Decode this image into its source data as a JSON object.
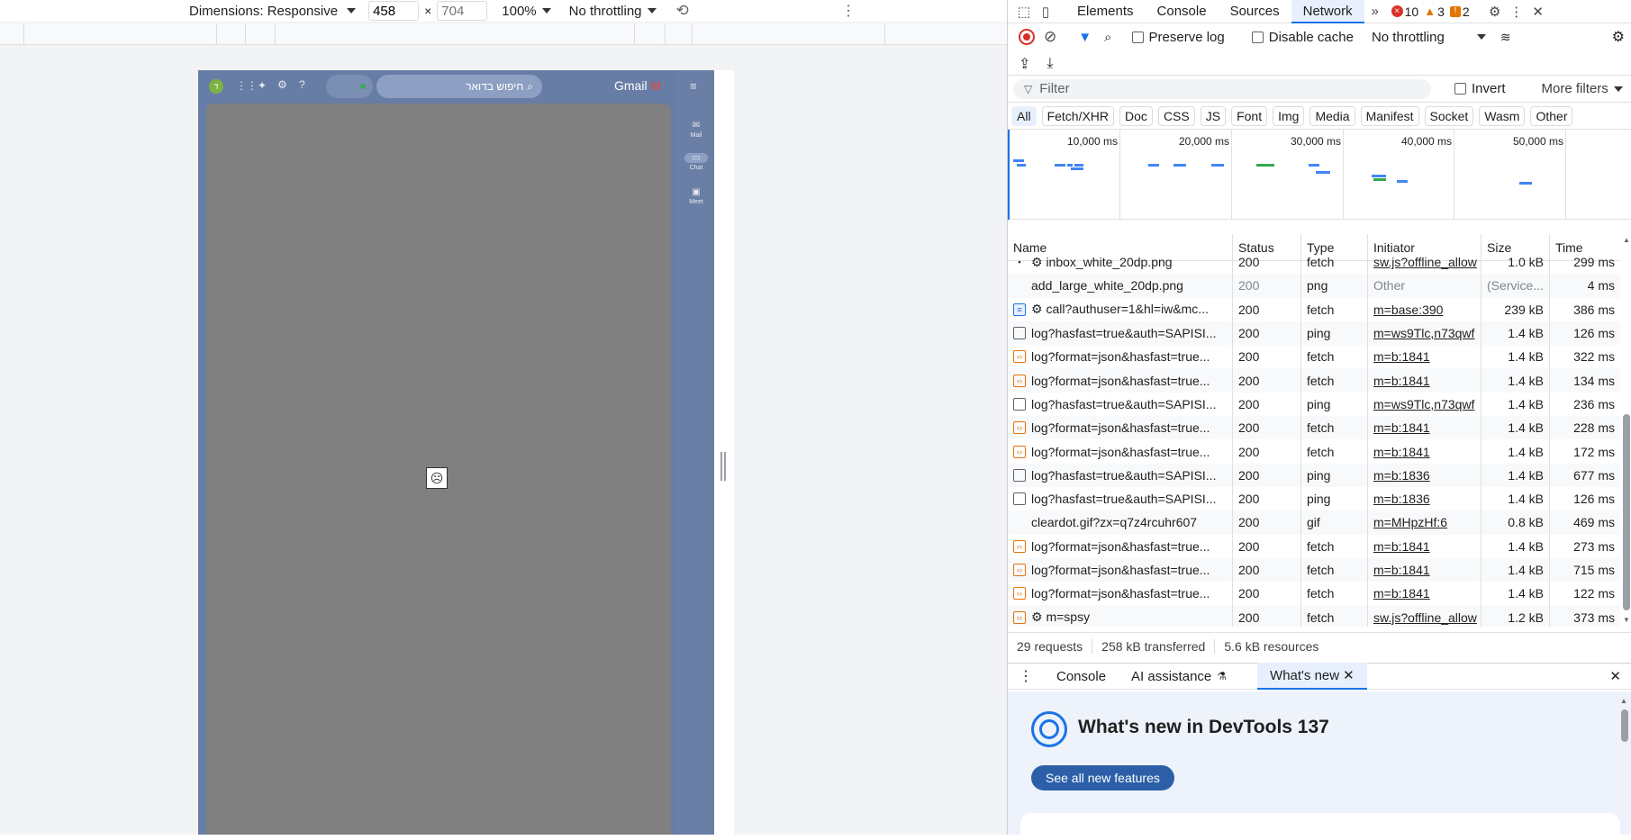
{
  "device_toolbar": {
    "dimensions_label": "Dimensions: Responsive",
    "width": "458",
    "height_placeholder": "704",
    "times": "×",
    "zoom": "100%",
    "throttling": "No throttling"
  },
  "gmail": {
    "search_placeholder": "חיפוש בדואר",
    "logo_text": "Gmail",
    "rail": [
      {
        "icon": "mail-icon",
        "label": "Mail"
      },
      {
        "icon": "chat-icon",
        "label": "Chat"
      },
      {
        "icon": "video-icon",
        "label": "Meet"
      }
    ],
    "avatar_letter": "ד"
  },
  "devtools": {
    "tabs": [
      "Elements",
      "Console",
      "Sources",
      "Network"
    ],
    "active_tab": "Network",
    "errors": "10",
    "warnings": "3",
    "issues": "2",
    "preserve_log": "Preserve log",
    "disable_cache": "Disable cache",
    "throttling": "No throttling",
    "filter_placeholder": "Filter",
    "invert": "Invert",
    "more_filters": "More filters",
    "type_filters": [
      "All",
      "Fetch/XHR",
      "Doc",
      "CSS",
      "JS",
      "Font",
      "Img",
      "Media",
      "Manifest",
      "Socket",
      "Wasm",
      "Other"
    ],
    "overview_labels": [
      "10,000 ms",
      "20,000 ms",
      "30,000 ms",
      "40,000 ms",
      "50,000 ms"
    ],
    "columns": [
      "Name",
      "Status",
      "Type",
      "Initiator",
      "Size",
      "Time"
    ],
    "rows": [
      {
        "icon": "img",
        "name": "⚙ inbox_white_20dp.png",
        "status": "200",
        "type": "fetch",
        "initiator": "sw.js?offline_allow",
        "size": "1.0 kB",
        "time": "299 ms"
      },
      {
        "icon": "none",
        "name": "add_large_white_20dp.png",
        "status": "200",
        "type": "png",
        "initiator": "Other",
        "size": "(Service...",
        "time": "4 ms",
        "dim": true
      },
      {
        "icon": "doc",
        "name": "⚙ call?authuser=1&hl=iw&mc...",
        "status": "200",
        "type": "fetch",
        "initiator": "m=base:390",
        "size": "239 kB",
        "time": "386 ms"
      },
      {
        "icon": "ping",
        "name": "log?hasfast=true&auth=SAPISI...",
        "status": "200",
        "type": "ping",
        "initiator": "m=ws9Tlc,n73qwf",
        "size": "1.4 kB",
        "time": "126 ms"
      },
      {
        "icon": "fetch",
        "name": "log?format=json&hasfast=true...",
        "status": "200",
        "type": "fetch",
        "initiator": "m=b:1841",
        "size": "1.4 kB",
        "time": "322 ms"
      },
      {
        "icon": "fetch",
        "name": "log?format=json&hasfast=true...",
        "status": "200",
        "type": "fetch",
        "initiator": "m=b:1841",
        "size": "1.4 kB",
        "time": "134 ms"
      },
      {
        "icon": "ping",
        "name": "log?hasfast=true&auth=SAPISI...",
        "status": "200",
        "type": "ping",
        "initiator": "m=ws9Tlc,n73qwf",
        "size": "1.4 kB",
        "time": "236 ms"
      },
      {
        "icon": "fetch",
        "name": "log?format=json&hasfast=true...",
        "status": "200",
        "type": "fetch",
        "initiator": "m=b:1841",
        "size": "1.4 kB",
        "time": "228 ms"
      },
      {
        "icon": "fetch",
        "name": "log?format=json&hasfast=true...",
        "status": "200",
        "type": "fetch",
        "initiator": "m=b:1841",
        "size": "1.4 kB",
        "time": "172 ms"
      },
      {
        "icon": "ping",
        "name": "log?hasfast=true&auth=SAPISI...",
        "status": "200",
        "type": "ping",
        "initiator": "m=b:1836",
        "size": "1.4 kB",
        "time": "677 ms"
      },
      {
        "icon": "ping",
        "name": "log?hasfast=true&auth=SAPISI...",
        "status": "200",
        "type": "ping",
        "initiator": "m=b:1836",
        "size": "1.4 kB",
        "time": "126 ms"
      },
      {
        "icon": "none",
        "name": "cleardot.gif?zx=q7z4rcuhr607",
        "status": "200",
        "type": "gif",
        "initiator": "m=MHpzHf:6",
        "size": "0.8 kB",
        "time": "469 ms"
      },
      {
        "icon": "fetch",
        "name": "log?format=json&hasfast=true...",
        "status": "200",
        "type": "fetch",
        "initiator": "m=b:1841",
        "size": "1.4 kB",
        "time": "273 ms"
      },
      {
        "icon": "fetch",
        "name": "log?format=json&hasfast=true...",
        "status": "200",
        "type": "fetch",
        "initiator": "m=b:1841",
        "size": "1.4 kB",
        "time": "715 ms"
      },
      {
        "icon": "fetch",
        "name": "log?format=json&hasfast=true...",
        "status": "200",
        "type": "fetch",
        "initiator": "m=b:1841",
        "size": "1.4 kB",
        "time": "122 ms"
      },
      {
        "icon": "fetch",
        "name": "⚙ m=spsy",
        "status": "200",
        "type": "fetch",
        "initiator": "sw.js?offline_allow",
        "size": "1.2 kB",
        "time": "373 ms"
      }
    ],
    "summary": {
      "requests": "29 requests",
      "transferred": "258 kB transferred",
      "resources": "5.6 kB resources"
    },
    "drawer_tabs": [
      "Console",
      "AI assistance",
      "What's new"
    ],
    "whats_new_title": "What's new in DevTools 137",
    "whats_new_button": "See all new features"
  }
}
